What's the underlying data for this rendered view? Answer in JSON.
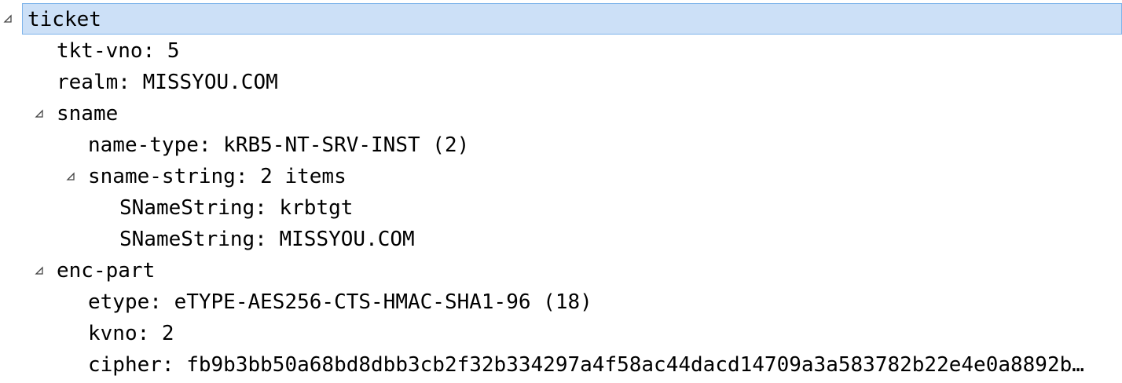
{
  "tree": {
    "nodes": [
      {
        "label": "ticket",
        "expanded": true,
        "selected": true
      },
      {
        "label": "tkt-vno: 5"
      },
      {
        "label": "realm: MISSYOU.COM"
      },
      {
        "label": "sname",
        "expanded": true
      },
      {
        "label": "name-type: kRB5-NT-SRV-INST (2)"
      },
      {
        "label": "sname-string: 2 items",
        "expanded": true
      },
      {
        "label": "SNameString: krbtgt"
      },
      {
        "label": "SNameString: MISSYOU.COM"
      },
      {
        "label": "enc-part",
        "expanded": true
      },
      {
        "label": "etype: eTYPE-AES256-CTS-HMAC-SHA1-96 (18)"
      },
      {
        "label": "kvno: 2"
      },
      {
        "label": "cipher: fb9b3bb50a68bd8dbb3cb2f32b334297a4f58ac44dacd14709a3a583782b22e4e0a8892b…"
      }
    ],
    "toggle_icon": "expanded-triangle-icon",
    "selection_color": "#cce0f7",
    "selection_border_color": "#7eb4ea"
  }
}
